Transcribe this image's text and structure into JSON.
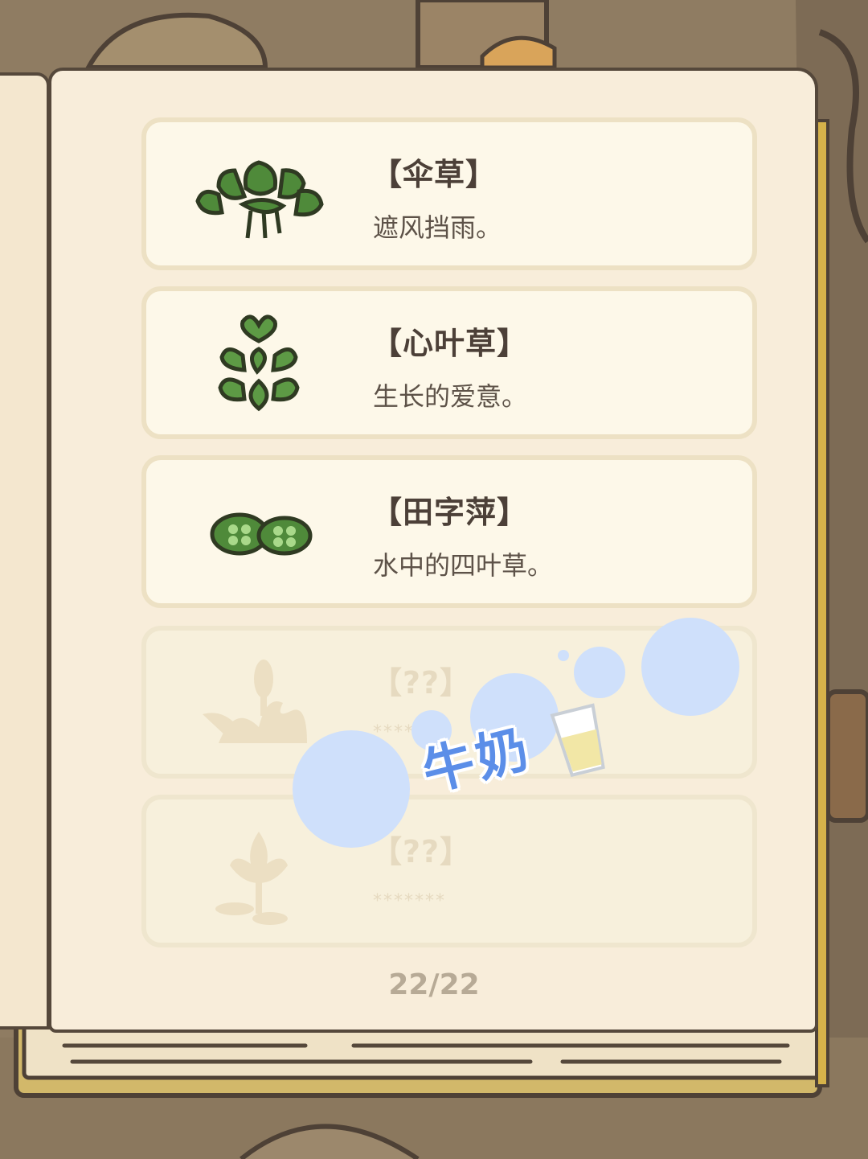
{
  "entries": [
    {
      "title": "【伞草】",
      "desc": "遮风挡雨。",
      "icon": "umbrella-grass-icon",
      "locked": false
    },
    {
      "title": "【心叶草】",
      "desc": "生长的爱意。",
      "icon": "heart-leaf-icon",
      "locked": false
    },
    {
      "title": "【田字萍】",
      "desc": "水中的四叶草。",
      "icon": "water-clover-icon",
      "locked": false
    },
    {
      "title": "【??】",
      "desc": "*******",
      "icon": "cattail-silhouette-icon",
      "locked": true
    },
    {
      "title": "【??】",
      "desc": "*******",
      "icon": "lotus-silhouette-icon",
      "locked": true
    }
  ],
  "page_indicator": "22/22",
  "sticker": {
    "text": "牛奶",
    "icon": "milk-glass-icon",
    "color": "#5b8ee8"
  },
  "colors": {
    "page": "#f8edda",
    "card": "#fdf8e9",
    "outline": "#55483b",
    "bubble": "#cfe0fb"
  }
}
